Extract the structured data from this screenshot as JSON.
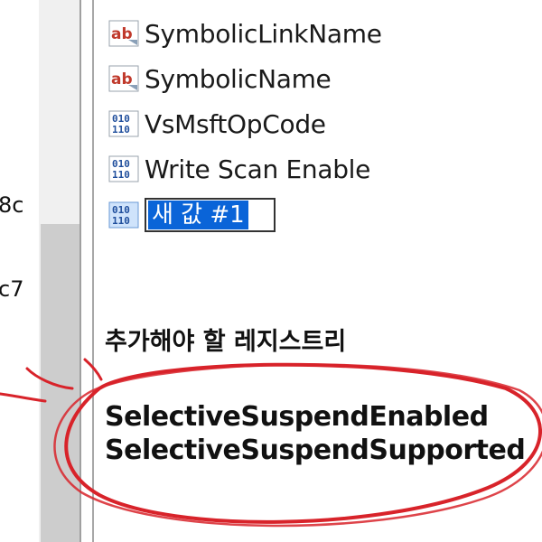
{
  "left_pane": {
    "fragments": [
      "8c",
      "c7"
    ]
  },
  "list": {
    "items": [
      {
        "label": "SymbolicLinkName",
        "icon": "string-value-icon"
      },
      {
        "label": "SymbolicName",
        "icon": "string-value-icon"
      },
      {
        "label": "VsMsftOpCode",
        "icon": "binary-value-icon"
      },
      {
        "label": "Write Scan Enable",
        "icon": "binary-value-icon"
      }
    ],
    "new_item": {
      "value": "새 값 #1",
      "icon": "binary-value-icon"
    }
  },
  "annotation": {
    "title": "추가해야 할 레지스트리",
    "lines": [
      "SelectiveSuspendEnabled",
      "SelectiveSuspendSupported"
    ],
    "color": "#d8232a"
  },
  "colors": {
    "string_icon": "#c0392b",
    "binary_icon": "#1f4e9c",
    "selection": "#0a64d8"
  }
}
